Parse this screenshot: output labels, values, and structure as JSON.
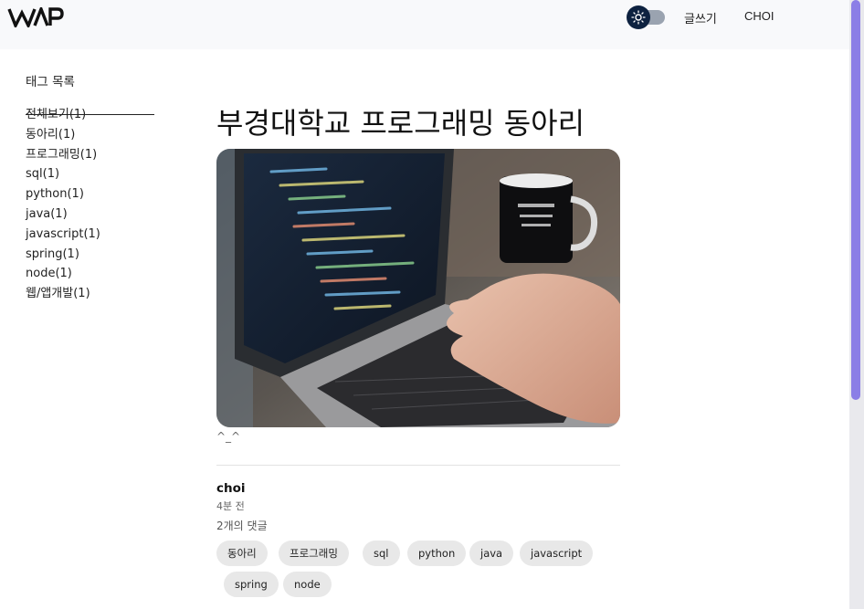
{
  "header": {
    "logo_text": "WAP",
    "theme_toggle_icon": "sun-icon",
    "write_label": "글쓰기",
    "user_label": "CHOI"
  },
  "sidebar": {
    "title": "태그 목록",
    "items": [
      {
        "label": "전체보기(1)"
      },
      {
        "label": "동아리(1)"
      },
      {
        "label": "프로그래밍(1)"
      },
      {
        "label": "sql(1)"
      },
      {
        "label": "python(1)"
      },
      {
        "label": "java(1)"
      },
      {
        "label": "javascript(1)"
      },
      {
        "label": "spring(1)"
      },
      {
        "label": "node(1)"
      },
      {
        "label": "웹/앱개발(1)"
      }
    ]
  },
  "post": {
    "title": "부경대학교 프로그래밍 동아리",
    "caption": "^_^",
    "author": "choi",
    "time": "4분 전",
    "comments": "2개의 댓글",
    "tags": [
      "동아리",
      "프로그래밍",
      "sql",
      "python",
      "java",
      "javascript",
      "spring",
      "node"
    ]
  },
  "colors": {
    "header_bg": "#f8f9fb",
    "scrollbar_thumb": "#8b7ee6",
    "toggle_knob": "#0d2240",
    "chip_bg": "#e8e8e8"
  }
}
